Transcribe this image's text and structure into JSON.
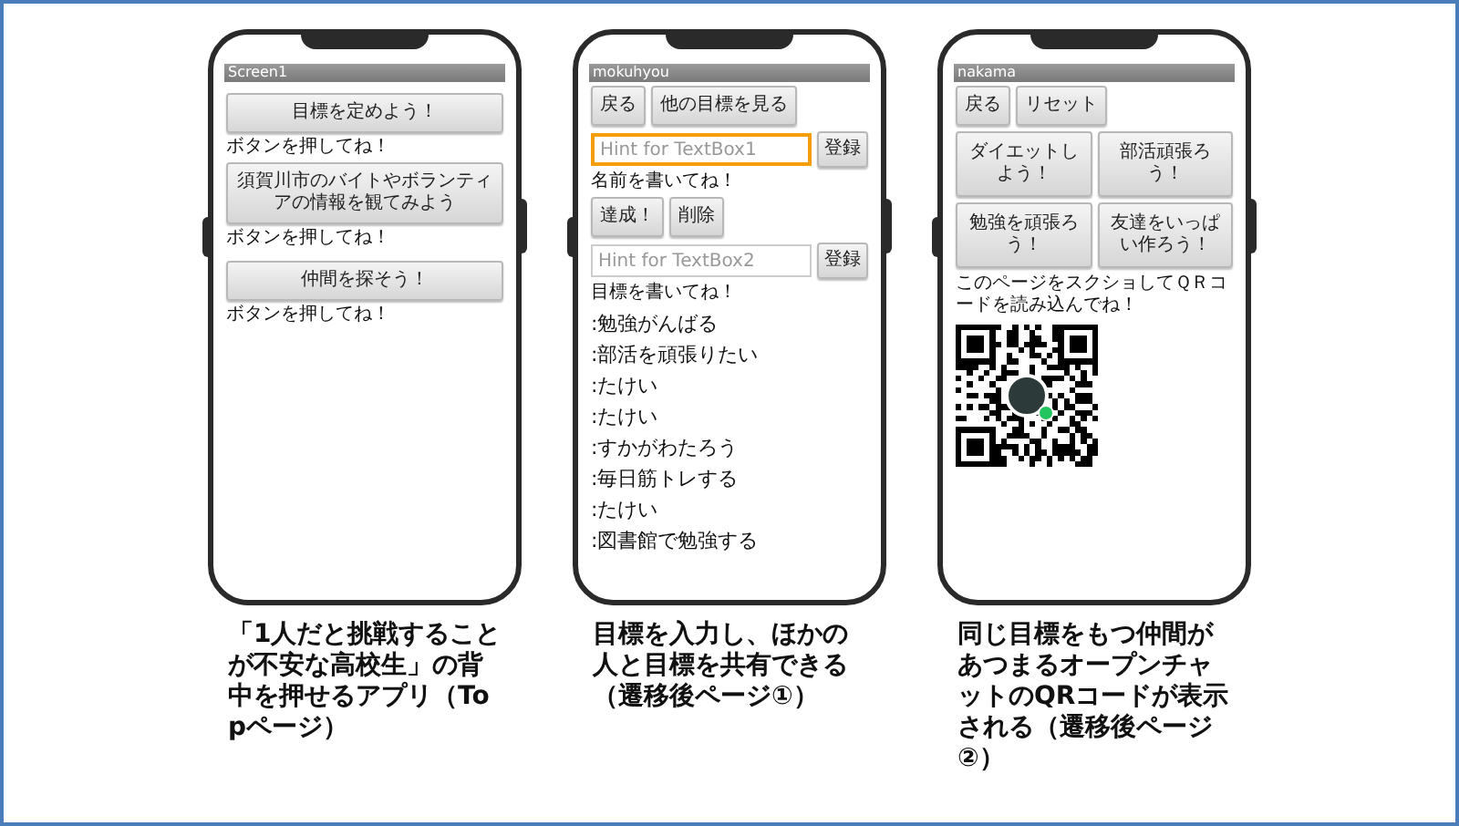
{
  "phones": [
    {
      "title": "Screen1",
      "items": [
        {
          "kind": "button",
          "text": "目標を定めよう！"
        },
        {
          "kind": "label",
          "text": "ボタンを押してね！"
        },
        {
          "kind": "button",
          "text": "須賀川市のバイトやボランティアの情報を観てみよう"
        },
        {
          "kind": "label",
          "text": "ボタンを押してね！"
        },
        {
          "kind": "button",
          "text": "仲間を探そう！"
        },
        {
          "kind": "label",
          "text": "ボタンを押してね！"
        }
      ],
      "caption": "「1人だと挑戦することが不安な高校生」の背中を押せるアプリ（Topページ）"
    },
    {
      "title": "mokuhyou",
      "items": [
        {
          "kind": "button_row",
          "buttons": [
            "戻る",
            "他の目標を見る"
          ]
        },
        {
          "kind": "input",
          "placeholder": "Hint for TextBox1",
          "focused": true,
          "button": "登録"
        },
        {
          "kind": "label",
          "text": "名前を書いてね！"
        },
        {
          "kind": "button_row",
          "buttons": [
            "達成！",
            "削除"
          ]
        },
        {
          "kind": "input",
          "placeholder": "Hint for TextBox2",
          "focused": false,
          "button": "登録"
        },
        {
          "kind": "label",
          "text": "目標を書いてね！"
        },
        {
          "kind": "list_item",
          "text": ":勉強がんばる"
        },
        {
          "kind": "list_item",
          "text": ":部活を頑張りたい"
        },
        {
          "kind": "list_item",
          "text": ":たけい"
        },
        {
          "kind": "list_item",
          "text": ":たけい"
        },
        {
          "kind": "list_item",
          "text": ":すかがわたろう"
        },
        {
          "kind": "list_item",
          "text": ":毎日筋トレする"
        },
        {
          "kind": "list_item",
          "text": ":たけい"
        },
        {
          "kind": "list_item",
          "text": ":図書館で勉強する"
        }
      ],
      "caption": "目標を入力し、ほかの人と目標を共有できる（遷移後ページ①）"
    },
    {
      "title": "nakama",
      "items": [
        {
          "kind": "button_row",
          "buttons": [
            "戻る",
            "リセット"
          ]
        },
        {
          "kind": "button_grid",
          "buttons": [
            "ダイエットしよう！",
            "部活頑張ろう！",
            "勉強を頑張ろう！",
            "友達をいっぱい作ろう！"
          ]
        },
        {
          "kind": "label",
          "text": "このページをスクショしてＱＲコードを読み込んでね！"
        },
        {
          "kind": "qr"
        }
      ],
      "caption": "同じ目標をもつ仲間があつまるオープンチャットのQRコードが表示される（遷移後ページ②）"
    }
  ]
}
